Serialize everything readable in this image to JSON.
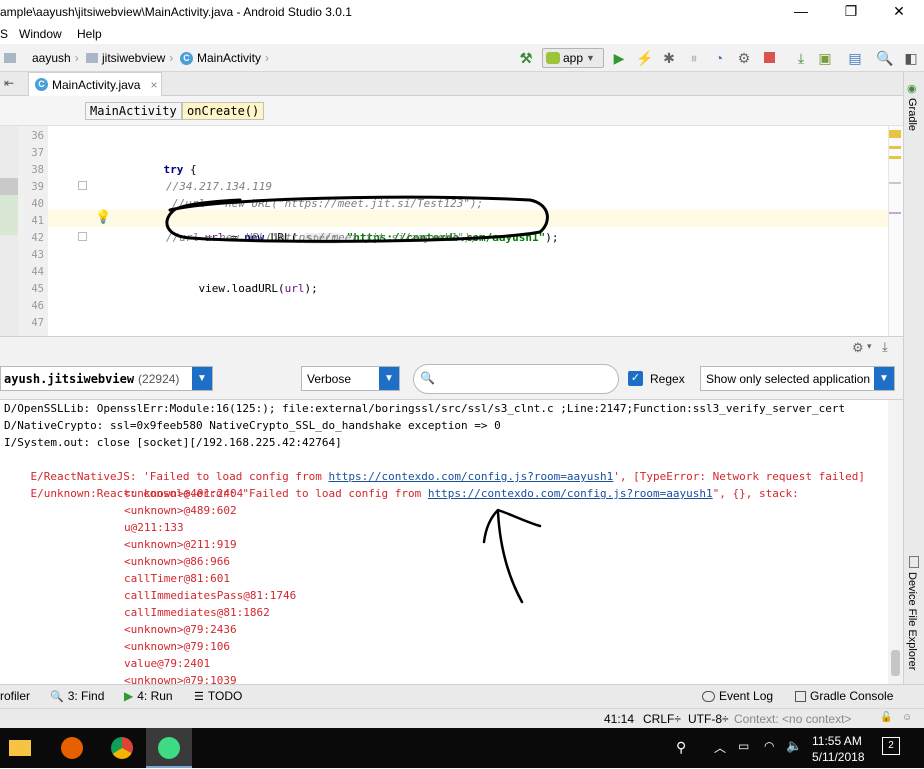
{
  "window": {
    "title": "ample\\aayush\\jitsiwebview\\MainActivity.java - Android Studio 3.0.1",
    "minimize": "—",
    "maximize": "❐",
    "close": "✕"
  },
  "menu": [
    "S",
    "Window",
    "Help"
  ],
  "nav": {
    "crumbs": [
      "aayush",
      "jitsiwebview",
      "MainActivity"
    ],
    "run_config": "app"
  },
  "editor": {
    "tab_label": "MainActivity.java",
    "tab_close": "×",
    "breadcrumb": [
      "MainActivity",
      "onCreate()"
    ],
    "line_numbers": [
      "36",
      "37",
      "38",
      "39",
      "40",
      "41",
      "42",
      "43",
      "44",
      "45",
      "46",
      "47"
    ],
    "lines": {
      "l37_kw": "try",
      "l37_rest": " {",
      "l39": "//34.217.134.119",
      "l40": "//url = new URL(\"https://meet.jit.si/Test123\");",
      "l41_var": "url",
      "l41_mid": " = ",
      "l41_kw": "new",
      "l41_call": " URL( ",
      "l41_hint": "spec:",
      "l41_str": "\"https://contexdo.com/aayush1\"",
      "l41_end": ");",
      "l42": "//url = new URL(\"https://meet.jit.si/aayush1\");",
      "l44_pre": "view.loadURL(",
      "l44_var": "url",
      "l44_end": ");"
    }
  },
  "logcat": {
    "device_label": "ayush.jitsiwebview",
    "pid": "(22924)",
    "level": "Verbose",
    "search_placeholder": "",
    "regex_label": "Regex",
    "regex_checked": true,
    "filter": "Show only selected application",
    "lines": [
      "D/OpenSSLLib: OpensslErr:Module:16(125:); file:external/boringssl/src/ssl/s3_clnt.c ;Line:2147;Function:ssl3_verify_server_cert",
      "D/NativeCrypto: ssl=0x9feeb580 NativeCrypto_SSL_do_handshake exception => 0",
      "I/System.out: close [socket][/192.168.225.42:42764]"
    ],
    "error1": {
      "pre": "E/ReactNativeJS: 'Failed to load config from ",
      "link": "https://contexdo.com/config.js?room=aayush1",
      "post": "', [TypeError: Network request failed]"
    },
    "error2": {
      "pre": "E/unknown:React: console.error: \"Failed to load config from ",
      "link": "https://contexdo.com/config.js?room=aayush1",
      "post": "\", {}, stack:"
    },
    "stack": [
      "<unknown>@401:2404",
      "<unknown>@489:602",
      "u@211:133",
      "<unknown>@211:919",
      "<unknown>@86:966",
      "callTimer@81:601",
      "callImmediatesPass@81:1746",
      "callImmediates@81:1862",
      "<unknown>@79:2436",
      "<unknown>@79:106",
      "value@79:2401",
      "<unknown>@79:1039"
    ]
  },
  "toolwindows": {
    "profiler": "rofiler",
    "find": "3: Find",
    "run": "4: Run",
    "todo": "TODO",
    "event_log": "Event Log",
    "gradle_console": "Gradle Console",
    "gradle": "Gradle",
    "device_file_explorer": "Device File Explorer"
  },
  "status": {
    "position": "41:14",
    "line_sep": "CRLF÷",
    "encoding": "UTF-8÷",
    "context": "Context: <no context>"
  },
  "taskbar": {
    "time": "11:55 AM",
    "date": "5/11/2018",
    "notifications": "2"
  },
  "colors": {
    "accent_blue": "#1c6ec7",
    "error_red": "#d3272d",
    "link_blue": "#1a4fa0",
    "string_green": "#008000",
    "keyword_navy": "#000080",
    "caret_line": "#fffae3"
  }
}
